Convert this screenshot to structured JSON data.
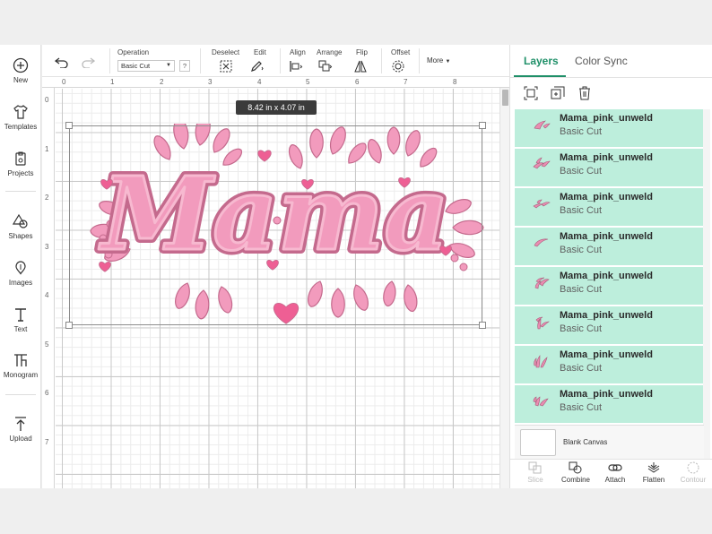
{
  "nav": {
    "items": [
      {
        "label": "New",
        "icon": "plus-circle-icon"
      },
      {
        "label": "Templates",
        "icon": "shirt-icon"
      },
      {
        "label": "Projects",
        "icon": "projects-icon"
      },
      {
        "label": "Shapes",
        "icon": "shapes-icon"
      },
      {
        "label": "Images",
        "icon": "images-icon"
      },
      {
        "label": "Text",
        "icon": "text-icon"
      },
      {
        "label": "Monogram",
        "icon": "monogram-icon"
      },
      {
        "label": "Upload",
        "icon": "upload-icon"
      }
    ]
  },
  "toolbar": {
    "operation_label": "Operation",
    "operation_value": "Basic Cut",
    "help": "?",
    "deselect": "Deselect",
    "edit": "Edit",
    "align": "Align",
    "arrange": "Arrange",
    "flip": "Flip",
    "offset": "Offset",
    "more": "More"
  },
  "canvas": {
    "ruler_top": [
      "0",
      "1",
      "2",
      "3",
      "4",
      "5",
      "6",
      "7",
      "8"
    ],
    "ruler_left": [
      "0",
      "1",
      "2",
      "3",
      "4",
      "5",
      "6",
      "7"
    ],
    "dimension": "8.42  in x 4.07  in",
    "artwork_text": "Mama",
    "artwork_color": "#f29bbd",
    "artwork_outline": "#c46a8d",
    "heart_color": "#ee5f94"
  },
  "panel": {
    "tabs": {
      "layers": "Layers",
      "sync": "Color Sync"
    },
    "layers": [
      {
        "name": "Mama_pink_unweld",
        "op": "Basic Cut"
      },
      {
        "name": "Mama_pink_unweld",
        "op": "Basic Cut"
      },
      {
        "name": "Mama_pink_unweld",
        "op": "Basic Cut"
      },
      {
        "name": "Mama_pink_unweld",
        "op": "Basic Cut"
      },
      {
        "name": "Mama_pink_unweld",
        "op": "Basic Cut"
      },
      {
        "name": "Mama_pink_unweld",
        "op": "Basic Cut"
      },
      {
        "name": "Mama_pink_unweld",
        "op": "Basic Cut"
      },
      {
        "name": "Mama_pink_unweld",
        "op": "Basic Cut"
      }
    ],
    "layer_bg": "#bdeedc",
    "blank_canvas": "Blank Canvas",
    "bottom": {
      "slice": "Slice",
      "combine": "Combine",
      "attach": "Attach",
      "flatten": "Flatten",
      "contour": "Contour"
    }
  }
}
